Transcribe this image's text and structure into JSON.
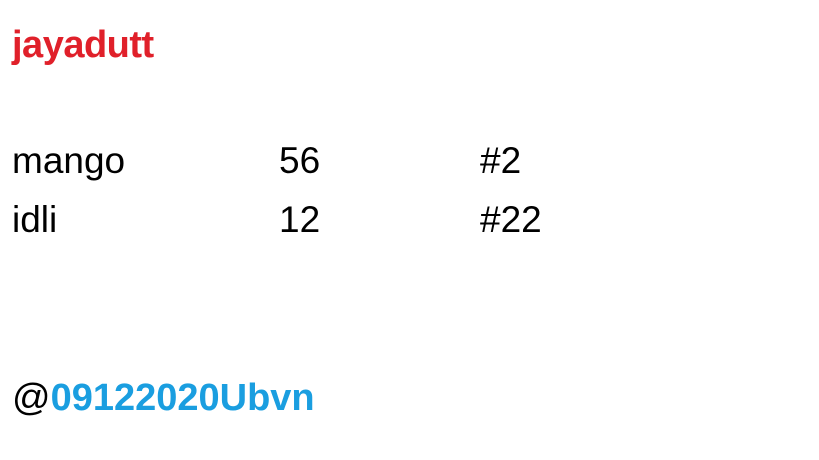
{
  "title": {
    "text": "jayadutt",
    "color": "#e0202a"
  },
  "rows": [
    {
      "name": "mango",
      "number": "56",
      "tag": "#2"
    },
    {
      "name": "idli",
      "number": "12",
      "tag": "#22"
    }
  ],
  "footer": {
    "at_symbol": "@",
    "handle": "09122020Ubvn",
    "handle_color": "#1a9ee0"
  }
}
